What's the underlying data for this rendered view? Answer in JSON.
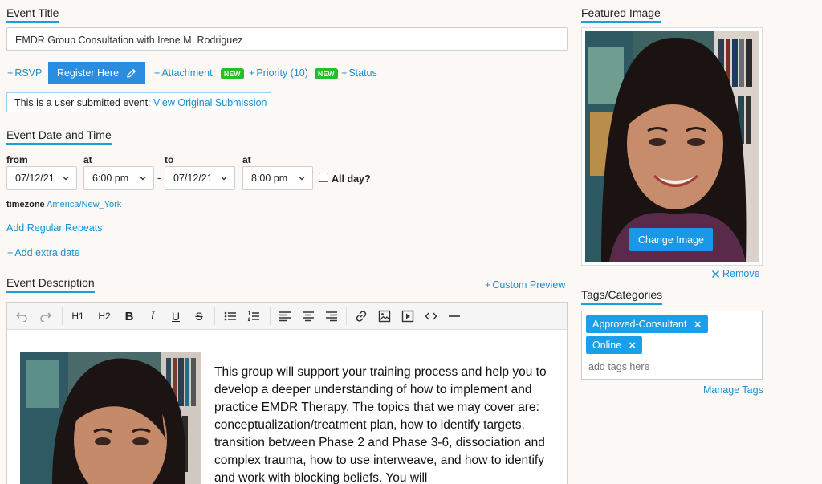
{
  "event_title": {
    "heading": "Event Title",
    "value": "EMDR Group Consultation with Irene M. Rodriguez"
  },
  "actions": {
    "rsvp": "RSVP",
    "register": "Register Here",
    "attachment": "Attachment",
    "new_badge": "NEW",
    "priority": "Priority (10)",
    "status": "Status"
  },
  "notice": {
    "text": "This is a user submitted event:",
    "link": "View Original Submission"
  },
  "date_time": {
    "heading": "Event Date and Time",
    "from_label": "from",
    "at_label": "at",
    "to_label": "to",
    "from_date": "07/12/21",
    "from_time": "6:00 pm",
    "dash": "-",
    "to_date": "07/12/21",
    "to_time": "8:00 pm",
    "all_day": "All day?",
    "timezone_label": "timezone",
    "timezone_value": "America/New_York",
    "add_repeats": "Add Regular Repeats",
    "add_extra_date": "Add extra date"
  },
  "description": {
    "heading": "Event Description",
    "custom_preview": "Custom Preview",
    "toolbar": {
      "h1": "H1",
      "h2": "H2",
      "bold": "B",
      "italic": "I",
      "underline": "U",
      "strike": "S"
    },
    "body": "This group will support your training process and help you to develop a deeper understanding of how to implement and practice EMDR Therapy. The topics that we may cover are: conceptualization/treatment plan, how to identify targets, transition between Phase 2 and Phase 3-6, dissociation and complex trauma, how to use interweave, and how to identify and work with blocking beliefs. You will"
  },
  "featured_image": {
    "heading": "Featured Image",
    "change_button": "Change Image",
    "remove": "Remove"
  },
  "tags": {
    "heading": "Tags/Categories",
    "items": [
      "Approved-Consultant",
      "Online"
    ],
    "placeholder": "add tags here",
    "manage": "Manage Tags"
  },
  "colors": {
    "accent": "#1aa0d8",
    "button": "#2a8de0",
    "badge": "#22c02a",
    "tag": "#1aa0e8"
  }
}
